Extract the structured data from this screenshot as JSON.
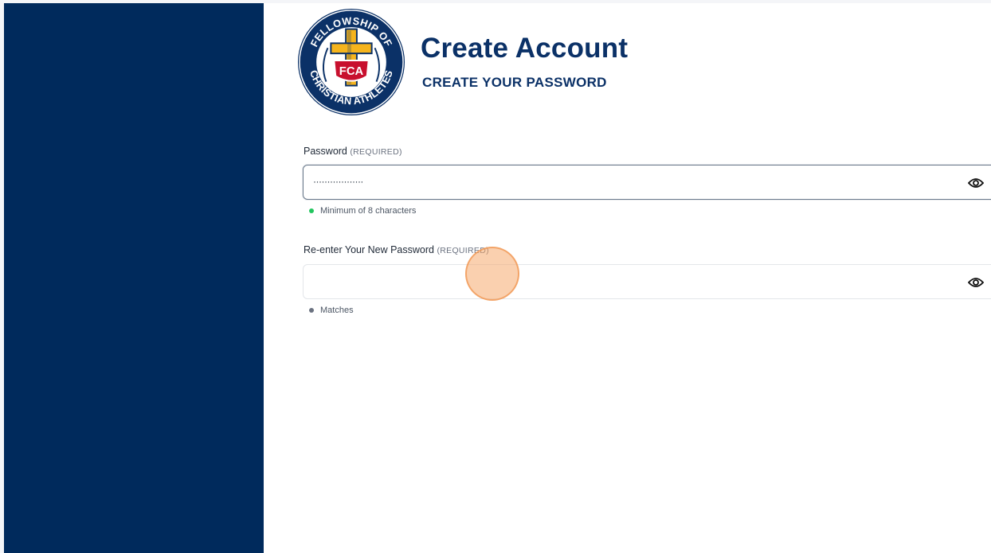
{
  "logo": {
    "arc_top": "FELLOWSHIP OF",
    "arc_bottom": "CHRISTIAN ATHLETES",
    "shield_text": "FCA"
  },
  "header": {
    "title": "Create Account",
    "subtitle": "CREATE YOUR PASSWORD"
  },
  "password_field": {
    "label": "Password",
    "required_tag": "(REQUIRED)",
    "value_masked": "··················",
    "toggle_icon": "eye-icon",
    "hint": "Minimum of 8 characters",
    "hint_status_color": "#22c55e"
  },
  "confirm_field": {
    "label": "Re-enter Your New Password",
    "required_tag": "(REQUIRED)",
    "value_masked": "",
    "toggle_icon": "eye-icon",
    "hint": "Matches",
    "hint_status_color": "#6b7280"
  },
  "colors": {
    "sidebar": "#002a5c",
    "heading": "#0b3167",
    "logo_gold": "#f5b41d",
    "logo_red": "#c8102e"
  }
}
